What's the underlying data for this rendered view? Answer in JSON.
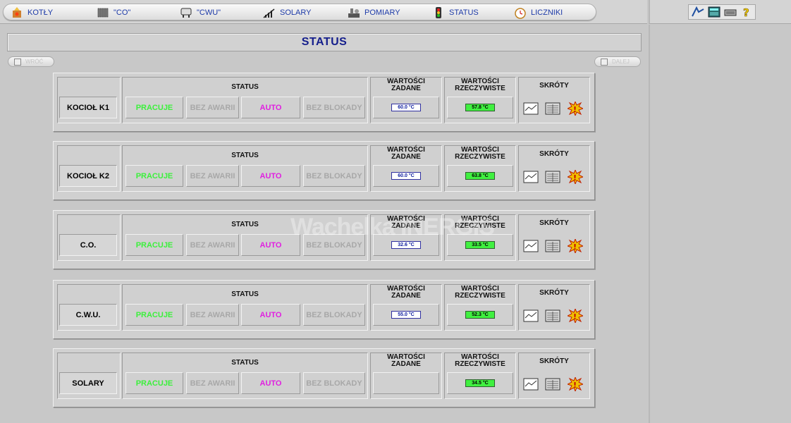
{
  "nav": {
    "items": [
      {
        "label": "KOTŁY",
        "icon": "boiler-icon"
      },
      {
        "label": "\"CO\"",
        "icon": "radiator-icon"
      },
      {
        "label": "\"CWU\"",
        "icon": "water-tank-icon"
      },
      {
        "label": "SOLARY",
        "icon": "solar-icon"
      },
      {
        "label": "POMIARY",
        "icon": "measurement-icon"
      },
      {
        "label": "STATUS",
        "icon": "traffic-light-icon"
      },
      {
        "label": "LICZNIKI",
        "icon": "clock-icon"
      }
    ]
  },
  "toolbox": [
    "logo-icon",
    "calculator-icon",
    "keyboard-icon",
    "help-icon"
  ],
  "page_title": "STATUS",
  "nav_buttons": {
    "prev": "WRÓĆ",
    "next": "DALEJ"
  },
  "watermark": "Wachelka INERGIS",
  "headers": {
    "status": "STATUS",
    "set_values_1": "WARTOŚCI",
    "set_values_2": "ZADANE",
    "actual_values_1": "WARTOŚCI",
    "actual_values_2": "RZECZYWISTE",
    "shortcuts": "SKRÓTY"
  },
  "rows": [
    {
      "name": "KOCIOŁ K1",
      "s1": "PRACUJE",
      "s2": "BEZ AWARII",
      "s3": "AUTO",
      "s4": "BEZ BLOKADY",
      "set": "60.0 °C",
      "act": "57.8 °C"
    },
    {
      "name": "KOCIOŁ K2",
      "s1": "PRACUJE",
      "s2": "BEZ AWARII",
      "s3": "AUTO",
      "s4": "BEZ BLOKADY",
      "set": "60.0 °C",
      "act": "63.8 °C"
    },
    {
      "name": "C.O.",
      "s1": "PRACUJE",
      "s2": "BEZ AWARII",
      "s3": "AUTO",
      "s4": "BEZ BLOKADY",
      "set": "32.6 °C",
      "act": "33.5 °C"
    },
    {
      "name": "C.W.U.",
      "s1": "PRACUJE",
      "s2": "BEZ AWARII",
      "s3": "AUTO",
      "s4": "BEZ BLOKADY",
      "set": "55.0 °C",
      "act": "52.3 °C"
    },
    {
      "name": "SOLARY",
      "s1": "PRACUJE",
      "s2": "BEZ AWARII",
      "s3": "AUTO",
      "s4": "BEZ BLOKADY",
      "set": "",
      "act": "34.5 °C"
    }
  ],
  "colors": {
    "running": "#3cf03c",
    "auto": "#e020e0",
    "inactive": "#a8a8a8",
    "title": "#141e8c"
  }
}
